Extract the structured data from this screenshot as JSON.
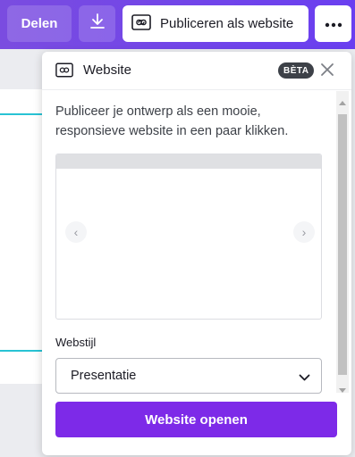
{
  "colors": {
    "toolbar_start": "#7a4ce0",
    "toolbar_end": "#6a3ff0",
    "primary_button": "#7d2ae8",
    "beta_badge": "#3d4148",
    "canvas_guide": "#28c3d4"
  },
  "toolbar": {
    "share_label": "Delen",
    "download_icon": "download-icon",
    "publish_label": "Publiceren als website",
    "publish_icon": "website-icon",
    "more_icon": "more-dots-icon"
  },
  "panel": {
    "title": "Website",
    "badge": "BÈTA",
    "close_icon": "close-icon",
    "description": "Publiceer je ontwerp als een mooie, responsieve website in een paar klikken.",
    "preview": {
      "prev_label": "‹",
      "next_label": "›"
    },
    "style": {
      "label": "Webstijl",
      "value": "Presentatie"
    },
    "open_button": "Website openen"
  }
}
